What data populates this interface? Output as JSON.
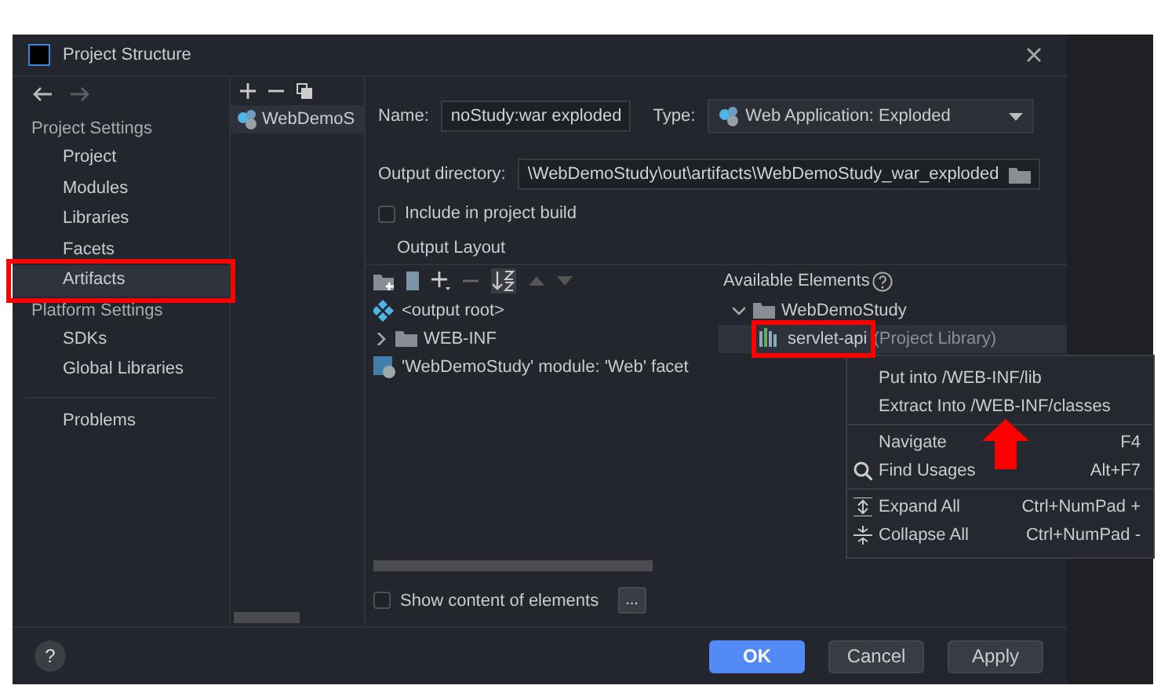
{
  "window": {
    "title": "Project Structure"
  },
  "sidebar": {
    "sections": [
      {
        "title": "Project Settings",
        "items": [
          {
            "label": "Project",
            "selected": false
          },
          {
            "label": "Modules",
            "selected": false
          },
          {
            "label": "Libraries",
            "selected": false
          },
          {
            "label": "Facets",
            "selected": false
          },
          {
            "label": "Artifacts",
            "selected": true
          }
        ]
      },
      {
        "title": "Platform Settings",
        "items": [
          {
            "label": "SDKs",
            "selected": false
          },
          {
            "label": "Global Libraries",
            "selected": false
          }
        ]
      },
      {
        "items": [
          {
            "label": "Problems",
            "selected": false
          }
        ]
      }
    ]
  },
  "artifacts": [
    {
      "label": "WebDemoS",
      "selected": true
    }
  ],
  "name_field": {
    "label": "Name:",
    "value": "noStudy:war exploded"
  },
  "type_field": {
    "label": "Type:",
    "value": "Web Application: Exploded"
  },
  "output_directory": {
    "label": "Output directory:",
    "value": "\\WebDemoStudy\\out\\artifacts\\WebDemoStudy_war_exploded"
  },
  "include_in_build": {
    "label": "Include in project build",
    "checked": false
  },
  "output_layout": {
    "title": "Output Layout",
    "items": [
      {
        "label": "<output root>",
        "kind": "root"
      },
      {
        "label": "WEB-INF",
        "kind": "folder",
        "expanded": false
      },
      {
        "label": "'WebDemoStudy' module: 'Web' facet",
        "kind": "facet"
      }
    ]
  },
  "available_elements": {
    "title": "Available Elements",
    "items": [
      {
        "label": "WebDemoStudy",
        "kind": "folder",
        "expanded": true,
        "selected": false,
        "children": [
          {
            "label": "servlet-api",
            "note": "(Project Library)",
            "kind": "library",
            "selected": true
          }
        ]
      }
    ]
  },
  "context_menu": {
    "groups": [
      [
        {
          "label": "Put into /WEB-INF/lib",
          "kind": "plain"
        },
        {
          "label": "Extract Into /WEB-INF/classes",
          "kind": "plain"
        }
      ],
      [
        {
          "label": "Navigate",
          "shortcut": "F4",
          "kind": "plain"
        },
        {
          "label": "Find Usages",
          "shortcut": "Alt+F7",
          "kind": "search"
        }
      ],
      [
        {
          "label": "Expand All",
          "shortcut": "Ctrl+NumPad +",
          "kind": "expand"
        },
        {
          "label": "Collapse All",
          "shortcut": "Ctrl+NumPad -",
          "kind": "collapse"
        }
      ]
    ]
  },
  "show_content": {
    "label": "Show content of elements",
    "checked": false,
    "button": "..."
  },
  "help_button": "?",
  "buttons": [
    {
      "label": "OK",
      "kind": "primary"
    },
    {
      "label": "Cancel",
      "kind": "normal"
    },
    {
      "label": "Apply",
      "kind": "normal"
    }
  ]
}
